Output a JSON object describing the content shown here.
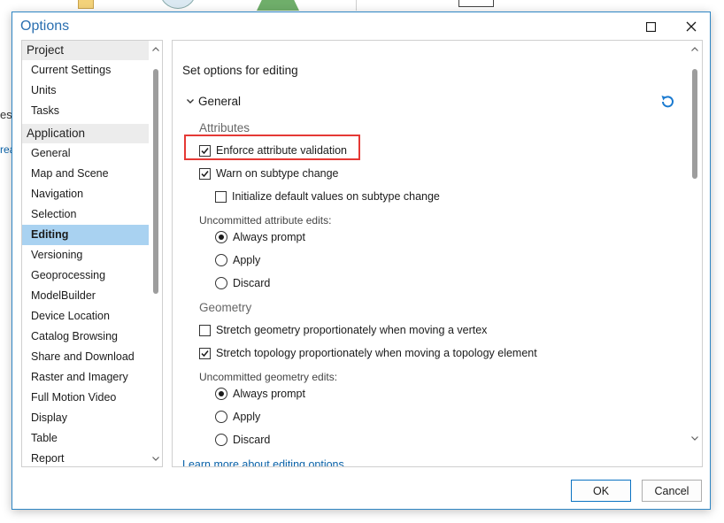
{
  "background": {
    "partial_text": "es",
    "partial_link": "rea"
  },
  "window": {
    "title": "Options",
    "maximize_icon": "maximize-icon",
    "close_icon": "close-icon"
  },
  "nav": {
    "groups": [
      {
        "label": "Project",
        "items": [
          "Current Settings",
          "Units",
          "Tasks"
        ]
      },
      {
        "label": "Application",
        "items": [
          "General",
          "Map and Scene",
          "Navigation",
          "Selection",
          "Editing",
          "Versioning",
          "Geoprocessing",
          "ModelBuilder",
          "Device Location",
          "Catalog Browsing",
          "Share and Download",
          "Raster and Imagery",
          "Full Motion Video",
          "Display",
          "Table",
          "Report"
        ]
      }
    ],
    "selected": "Editing"
  },
  "content": {
    "title": "Set options for editing",
    "section": "General",
    "reset_icon": "reset-icon",
    "attributes": {
      "heading": "Attributes",
      "enforce_validation": {
        "label": "Enforce attribute validation",
        "checked": true
      },
      "warn_subtype": {
        "label": "Warn on subtype change",
        "checked": true
      },
      "init_defaults": {
        "label": "Initialize default values on subtype change",
        "checked": false
      },
      "uncommitted_label": "Uncommitted attribute edits:",
      "radios": [
        {
          "label": "Always prompt",
          "selected": true
        },
        {
          "label": "Apply",
          "selected": false
        },
        {
          "label": "Discard",
          "selected": false
        }
      ]
    },
    "geometry": {
      "heading": "Geometry",
      "stretch_vertex": {
        "label": "Stretch geometry proportionately when moving a vertex",
        "checked": false
      },
      "stretch_topology": {
        "label": "Stretch topology proportionately when moving a topology element",
        "checked": true
      },
      "uncommitted_label": "Uncommitted geometry edits:",
      "radios": [
        {
          "label": "Always prompt",
          "selected": true
        },
        {
          "label": "Apply",
          "selected": false
        },
        {
          "label": "Discard",
          "selected": false
        }
      ]
    },
    "learn_more": "Learn more about editing options"
  },
  "buttons": {
    "ok": "OK",
    "cancel": "Cancel"
  },
  "colors": {
    "accent": "#2a6fb0",
    "selection": "#a9d2f1",
    "highlight_box": "#e53935",
    "link": "#0a62a8"
  }
}
